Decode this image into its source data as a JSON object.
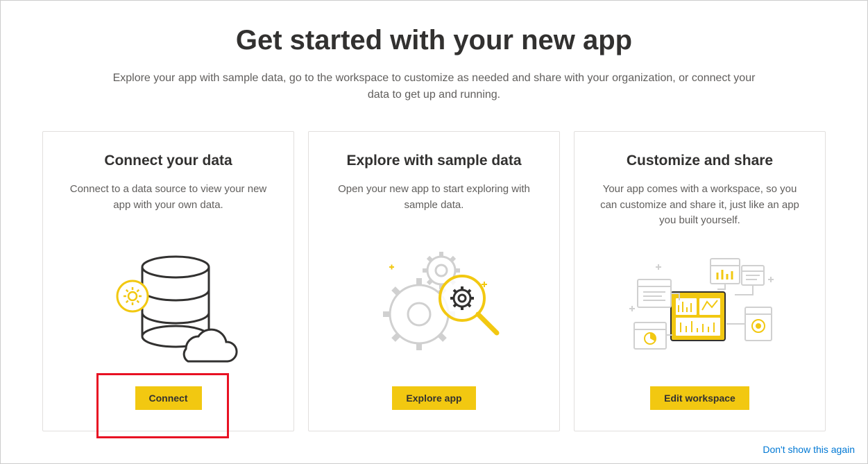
{
  "header": {
    "title": "Get started with your new app",
    "subtitle": "Explore your app with sample data, go to the workspace to customize as needed and share with your organization, or connect your data to get up and running."
  },
  "cards": [
    {
      "title": "Connect your data",
      "description": "Connect to a data source to view your new app with your own data.",
      "button_label": "Connect"
    },
    {
      "title": "Explore with sample data",
      "description": "Open your new app to start exploring with sample data.",
      "button_label": "Explore app"
    },
    {
      "title": "Customize and share",
      "description": "Your app comes with a workspace, so you can customize and share it, just like an app you built yourself.",
      "button_label": "Edit workspace"
    }
  ],
  "footer": {
    "dont_show_label": "Don't show this again"
  },
  "colors": {
    "accent": "#F2C811",
    "highlight": "#e81123",
    "link": "#0078d4"
  }
}
